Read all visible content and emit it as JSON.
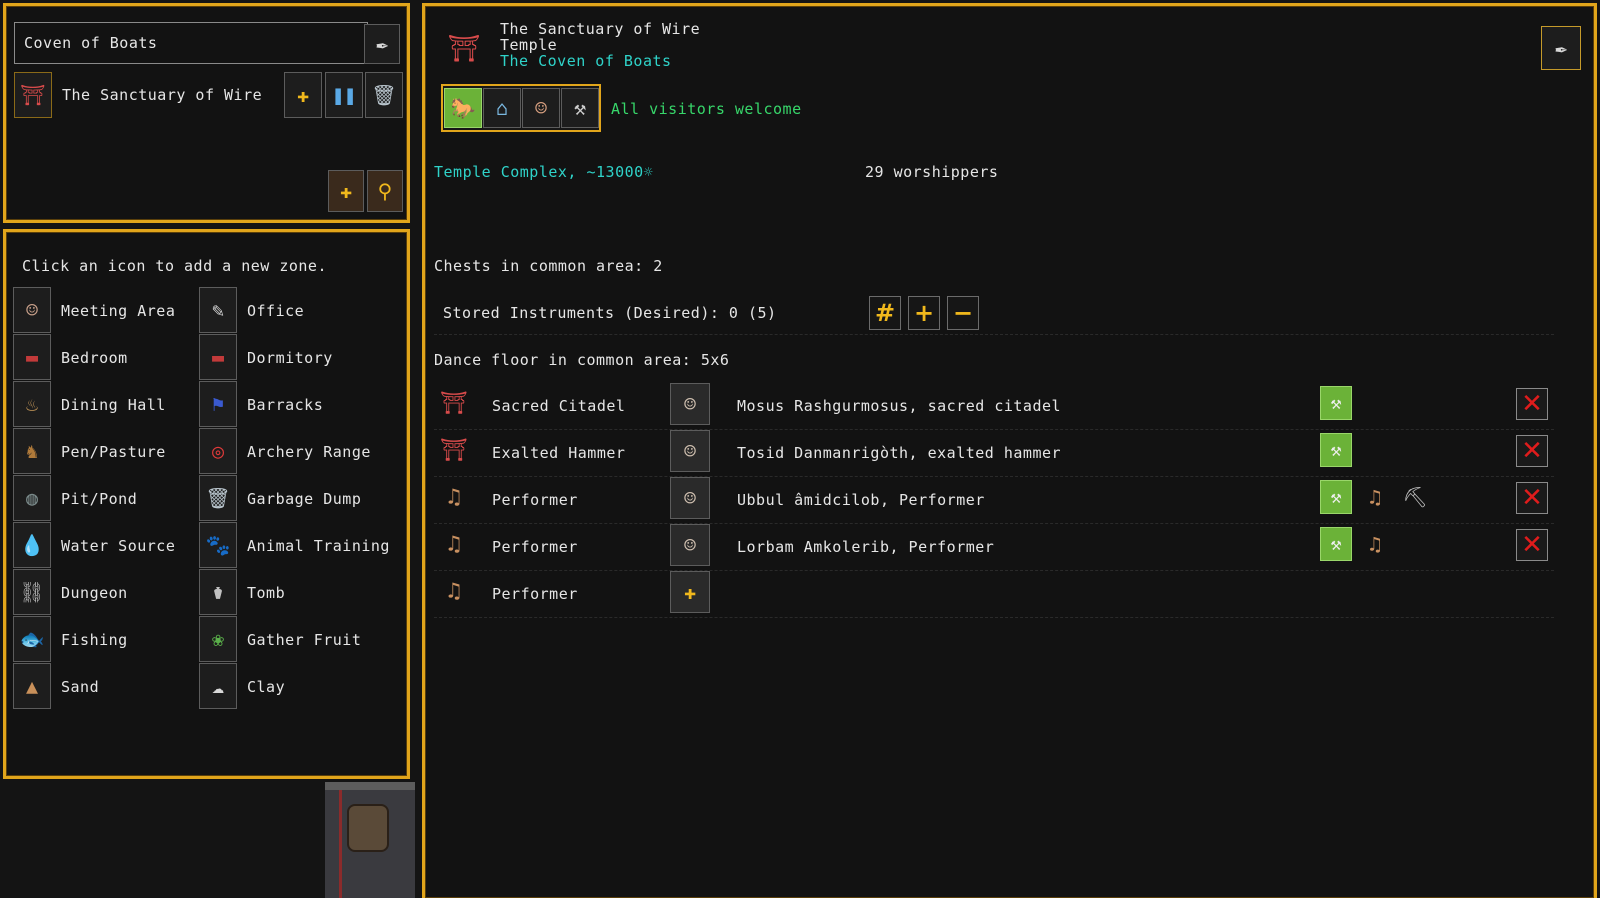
{
  "location_panel": {
    "title": "Coven of Boats",
    "item_label": "The Sanctuary of Wire"
  },
  "zones_panel": {
    "hint": "Click an icon to add a new zone.",
    "left_items": [
      {
        "label": "Meeting Area",
        "icon": "meeting-area-icon"
      },
      {
        "label": "Bedroom",
        "icon": "bedroom-icon"
      },
      {
        "label": "Dining Hall",
        "icon": "dining-hall-icon"
      },
      {
        "label": "Pen/Pasture",
        "icon": "horse-icon"
      },
      {
        "label": "Pit/Pond",
        "icon": "pit-pond-icon"
      },
      {
        "label": "Water Source",
        "icon": "water-source-icon"
      },
      {
        "label": "Dungeon",
        "icon": "dungeon-icon"
      },
      {
        "label": "Fishing",
        "icon": "fishing-icon"
      },
      {
        "label": "Sand",
        "icon": "sand-icon"
      }
    ],
    "right_items": [
      {
        "label": "Office",
        "icon": "office-icon"
      },
      {
        "label": "Dormitory",
        "icon": "dormitory-icon"
      },
      {
        "label": "Barracks",
        "icon": "barracks-icon"
      },
      {
        "label": "Archery Range",
        "icon": "archery-target-icon"
      },
      {
        "label": "Garbage Dump",
        "icon": "trash-icon"
      },
      {
        "label": "Animal Training",
        "icon": "animal-training-icon"
      },
      {
        "label": "Tomb",
        "icon": "tomb-icon"
      },
      {
        "label": "Gather Fruit",
        "icon": "gather-fruit-icon"
      },
      {
        "label": "Clay",
        "icon": "clay-icon"
      }
    ]
  },
  "details": {
    "name": "The Sanctuary of Wire",
    "type": "Temple",
    "owner": "The Coven of Boats",
    "visitor_policy": "All visitors welcome",
    "complex": "Temple Complex, ~13000☼",
    "worshippers": "29 worshippers",
    "chests": "Chests in common area: 2",
    "instruments": "Stored Instruments (Desired): 0 (5)",
    "dance_floor": "Dance floor in common area: 5x6",
    "positions": [
      {
        "role": "Sacred Citadel",
        "holder": "Mosus Rashgurmosus, sacred citadel",
        "role_icon": "temple-icon",
        "extras": []
      },
      {
        "role": "Exalted Hammer",
        "holder": "Tosid Danmanrigòth, exalted hammer",
        "role_icon": "temple-icon",
        "extras": []
      },
      {
        "role": "Performer",
        "holder": "Ubbul âmidcilob, Performer",
        "role_icon": "harp-icon",
        "extras": [
          "harp-icon",
          "pickaxe-icon"
        ]
      },
      {
        "role": "Performer",
        "holder": "Lorbam Amkolerib, Performer",
        "role_icon": "harp-icon",
        "extras": [
          "harp-icon"
        ]
      },
      {
        "role": "Performer",
        "holder": "",
        "role_icon": "harp-icon",
        "extras": []
      }
    ]
  },
  "colors": {
    "border": "#e1a51b",
    "cyan_text": "#2fd3c9",
    "green_text": "#37d66a",
    "remove_x": "#e01c1c",
    "hammer_button": "#6bb238"
  }
}
